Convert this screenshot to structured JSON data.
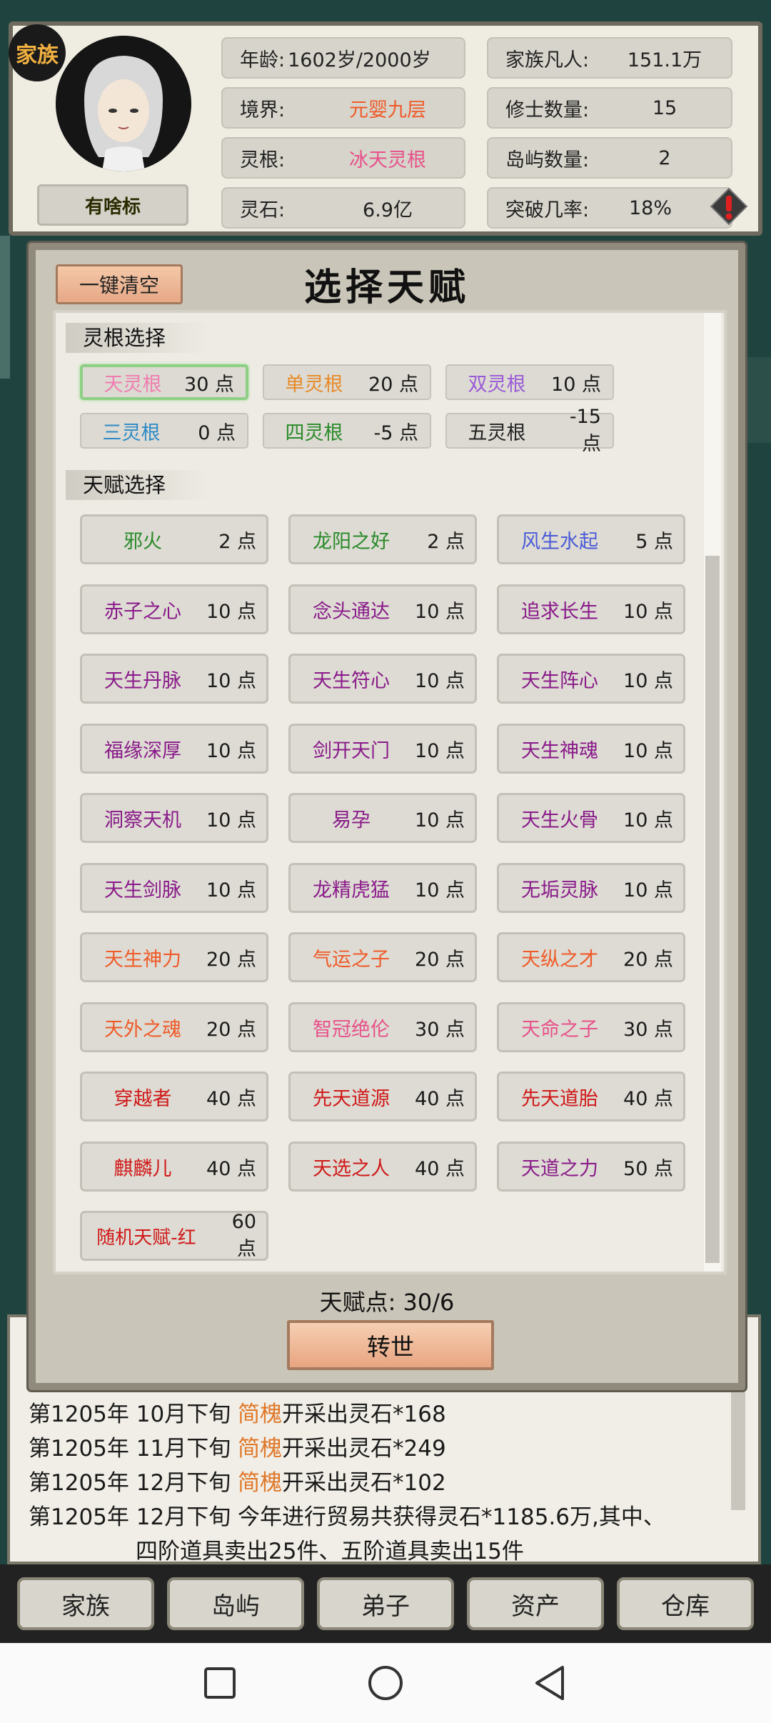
{
  "header": {
    "clan_badge": "家族",
    "nickname": "有啥标",
    "stats_left": [
      {
        "label": "年龄:",
        "value": "1602岁/2000岁",
        "color": "#222222",
        "combined": true
      },
      {
        "label": "境界:",
        "value": "元婴九层",
        "color": "#f05a28"
      },
      {
        "label": "灵根:",
        "value": "冰天灵根",
        "color": "#e8508a"
      },
      {
        "label": "灵石:",
        "value": "6.9亿",
        "color": "#222222"
      }
    ],
    "stats_right": [
      {
        "label": "家族凡人:",
        "value": "151.1万"
      },
      {
        "label": "修士数量:",
        "value": "15"
      },
      {
        "label": "岛屿数量:",
        "value": "2"
      },
      {
        "label": "突破几率:",
        "value": "18%"
      }
    ],
    "alert_icon": "exclamation-diamond-icon"
  },
  "modal": {
    "clear_button": "一键清空",
    "title": "选择天赋",
    "root_section_label": "灵根选择",
    "talent_section_label": "天赋选择",
    "roots": [
      {
        "name": "天灵根",
        "points": "30 点",
        "color": "#f07cb0",
        "selected": true
      },
      {
        "name": "单灵根",
        "points": "20 点",
        "color": "#e88a2a",
        "selected": false
      },
      {
        "name": "双灵根",
        "points": "10 点",
        "color": "#9a5ad8",
        "selected": false
      },
      {
        "name": "三灵根",
        "points": "0 点",
        "color": "#2d8ac8",
        "selected": false
      },
      {
        "name": "四灵根",
        "points": "-5 点",
        "color": "#2a8a2a",
        "selected": false
      },
      {
        "name": "五灵根",
        "points": "-15 点",
        "color": "#222222",
        "selected": false
      }
    ],
    "talents": [
      {
        "name": "邪火",
        "points": "2 点",
        "color": "#2a8a2a"
      },
      {
        "name": "龙阳之好",
        "points": "2 点",
        "color": "#2a8a2a"
      },
      {
        "name": "风生水起",
        "points": "5 点",
        "color": "#4a5ad8"
      },
      {
        "name": "赤子之心",
        "points": "10 点",
        "color": "#8a1a8a"
      },
      {
        "name": "念头通达",
        "points": "10 点",
        "color": "#8a1a8a"
      },
      {
        "name": "追求长生",
        "points": "10 点",
        "color": "#8a1a8a"
      },
      {
        "name": "天生丹脉",
        "points": "10 点",
        "color": "#8a1a8a"
      },
      {
        "name": "天生符心",
        "points": "10 点",
        "color": "#8a1a8a"
      },
      {
        "name": "天生阵心",
        "points": "10 点",
        "color": "#8a1a8a"
      },
      {
        "name": "福缘深厚",
        "points": "10 点",
        "color": "#8a1a8a"
      },
      {
        "name": "剑开天门",
        "points": "10 点",
        "color": "#8a1a8a"
      },
      {
        "name": "天生神魂",
        "points": "10 点",
        "color": "#8a1a8a"
      },
      {
        "name": "洞察天机",
        "points": "10 点",
        "color": "#8a1a8a"
      },
      {
        "name": "易孕",
        "points": "10 点",
        "color": "#8a1a8a"
      },
      {
        "name": "天生火骨",
        "points": "10 点",
        "color": "#8a1a8a"
      },
      {
        "name": "天生剑脉",
        "points": "10 点",
        "color": "#8a1a8a"
      },
      {
        "name": "龙精虎猛",
        "points": "10 点",
        "color": "#8a1a8a"
      },
      {
        "name": "无垢灵脉",
        "points": "10 点",
        "color": "#8a1a8a"
      },
      {
        "name": "天生神力",
        "points": "20 点",
        "color": "#f05a28"
      },
      {
        "name": "气运之子",
        "points": "20 点",
        "color": "#f05a28"
      },
      {
        "name": "天纵之才",
        "points": "20 点",
        "color": "#f05a28"
      },
      {
        "name": "天外之魂",
        "points": "20 点",
        "color": "#f05a28"
      },
      {
        "name": "智冠绝伦",
        "points": "30 点",
        "color": "#e8508a"
      },
      {
        "name": "天命之子",
        "points": "30 点",
        "color": "#e8508a"
      },
      {
        "name": "穿越者",
        "points": "40 点",
        "color": "#d01818"
      },
      {
        "name": "先天道源",
        "points": "40 点",
        "color": "#d01818"
      },
      {
        "name": "先天道胎",
        "points": "40 点",
        "color": "#d01818"
      },
      {
        "name": "麒麟儿",
        "points": "40 点",
        "color": "#d01818"
      },
      {
        "name": "天选之人",
        "points": "40 点",
        "color": "#d01818"
      },
      {
        "name": "天道之力",
        "points": "50 点",
        "color": "#8a1a8a"
      },
      {
        "name": "随机天赋-红",
        "points": "60 点",
        "color": "#d01818"
      }
    ],
    "points_line": "天赋点:  30/6",
    "rebirth_button": "转世"
  },
  "log": {
    "lines": [
      {
        "prefix": "第1205年 10月下旬 ",
        "who": "简槐",
        "rest": "开采出灵石*168"
      },
      {
        "prefix": "第1205年 11月下旬 ",
        "who": "简槐",
        "rest": "开采出灵石*249"
      },
      {
        "prefix": "第1205年 12月下旬 ",
        "who": "简槐",
        "rest": "开采出灵石*102"
      },
      {
        "prefix": "第1205年 12月下旬 今年进行贸易共获得灵石*1185.6万,其中、",
        "who": "",
        "rest": ""
      },
      {
        "prefix": "四阶道具卖出25件、五阶道具卖出15件",
        "who": "",
        "rest": ""
      }
    ]
  },
  "nav": {
    "items": [
      "家族",
      "岛屿",
      "弟子",
      "资产",
      "仓库"
    ]
  },
  "system_bar": {
    "icons": [
      "square-icon",
      "circle-icon",
      "triangle-back-icon"
    ]
  }
}
